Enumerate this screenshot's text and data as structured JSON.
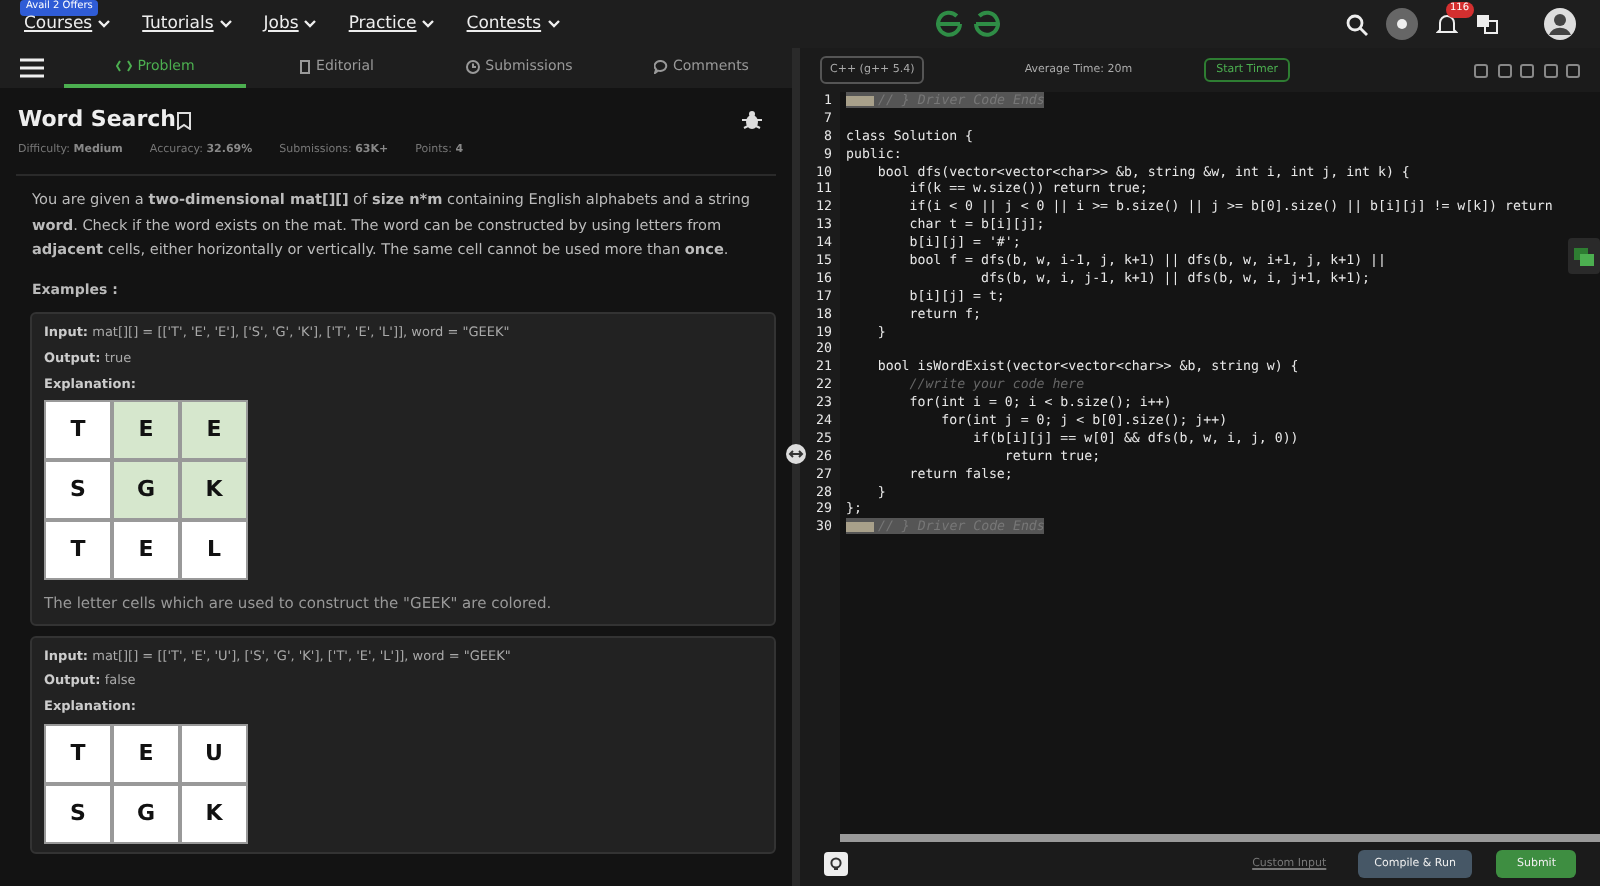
{
  "navbar": {
    "offer_badge": "Avail 2 Offers",
    "menus": [
      "Courses",
      "Tutorials",
      "Jobs",
      "Practice",
      "Contests"
    ],
    "notification_count": "116"
  },
  "tabs": [
    {
      "label": "Problem",
      "selected": true
    },
    {
      "label": "Editorial",
      "selected": false
    },
    {
      "label": "Submissions",
      "selected": false
    },
    {
      "label": "Comments",
      "selected": false
    }
  ],
  "problem": {
    "title": "Word Search",
    "meta": [
      {
        "label": "Difficulty:",
        "value": "Medium"
      },
      {
        "label": "Accuracy:",
        "value": "32.69%"
      },
      {
        "label": "Submissions:",
        "value": "63K+"
      },
      {
        "label": "Points:",
        "value": "4"
      }
    ],
    "description": "You are given a **two-dimensional mat[][]** of **size n*m** containing English alphabets and a string **word**. Check if the word exists on the mat. The word can be constructed by using letters from **adjacent** cells, either horizontally or vertically. The same cell cannot be used more than **once**.",
    "examples_heading": "Examples :",
    "examples": [
      {
        "input_label": "Input:",
        "input": "mat[][] = [['T', 'E', 'E'], ['S', 'G', 'K'], ['T', 'E', 'L']], word = \"GEEK\"",
        "output_label": "Output:",
        "output": "true",
        "explanation_label": "Explanation:",
        "grid": [
          [
            {
              "letter": "T",
              "highlighted": false
            },
            {
              "letter": "E",
              "highlighted": true
            },
            {
              "letter": "E",
              "highlighted": true
            }
          ],
          [
            {
              "letter": "S",
              "highlighted": false
            },
            {
              "letter": "G",
              "highlighted": true
            },
            {
              "letter": "K",
              "highlighted": true
            }
          ],
          [
            {
              "letter": "T",
              "highlighted": false
            },
            {
              "letter": "E",
              "highlighted": false
            },
            {
              "letter": "L",
              "highlighted": false
            }
          ]
        ],
        "note": "The letter cells which are used to construct the \"GEEK\" are colored."
      },
      {
        "input_label": "Input:",
        "input": "mat[][] = [['T', 'E', 'U'], ['S', 'G', 'K'], ['T', 'E', 'L']], word = \"GEEK\"",
        "output_label": "Output:",
        "output": "false",
        "explanation_label": "Explanation:",
        "grid": [
          [
            {
              "letter": "T",
              "highlighted": false
            },
            {
              "letter": "E",
              "highlighted": false
            },
            {
              "letter": "U",
              "highlighted": false
            }
          ],
          [
            {
              "letter": "S",
              "highlighted": false
            },
            {
              "letter": "G",
              "highlighted": false
            },
            {
              "letter": "K",
              "highlighted": false
            }
          ]
        ]
      }
    ]
  },
  "editor": {
    "language": "C++ (g++ 5.4)",
    "average_time": "Average Time: 20m",
    "timer_button": "Start Timer",
    "lines": [
      {
        "number": "1",
        "kind": "folded",
        "text": "// } Driver Code Ends"
      },
      {
        "number": "7",
        "kind": "code"
      },
      {
        "number": "8",
        "kind": "code",
        "text": "class Solution {"
      },
      {
        "number": "9",
        "kind": "code",
        "text": "public:"
      },
      {
        "number": "10",
        "kind": "code",
        "text": "    bool dfs(vector<vector<char>> &b, string &w, int i, int j, int k) {"
      },
      {
        "number": "11",
        "kind": "code",
        "text": "        if(k == w.size()) return true;"
      },
      {
        "number": "12",
        "kind": "code",
        "text": "        if(i < 0 || j < 0 || i >= b.size() || j >= b[0].size() || b[i][j] != w[k]) return"
      },
      {
        "number": "13",
        "kind": "code",
        "text": "        char t = b[i][j];"
      },
      {
        "number": "14",
        "kind": "code",
        "text": "        b[i][j] = '#';"
      },
      {
        "number": "15",
        "kind": "code",
        "text": "        bool f = dfs(b, w, i-1, j, k+1) || dfs(b, w, i+1, j, k+1) ||"
      },
      {
        "number": "16",
        "kind": "code",
        "text": "                 dfs(b, w, i, j-1, k+1) || dfs(b, w, i, j+1, k+1);"
      },
      {
        "number": "17",
        "kind": "code",
        "text": "        b[i][j] = t;"
      },
      {
        "number": "18",
        "kind": "code",
        "text": "        return f;"
      },
      {
        "number": "19",
        "kind": "code",
        "text": "    }"
      },
      {
        "number": "20",
        "kind": "code"
      },
      {
        "number": "21",
        "kind": "code",
        "text": "    bool isWordExist(vector<vector<char>> &b, string w) {"
      },
      {
        "number": "22",
        "kind": "comment",
        "text": "        //write your code here"
      },
      {
        "number": "23",
        "kind": "code",
        "text": "        for(int i = 0; i < b.size(); i++)"
      },
      {
        "number": "24",
        "kind": "code",
        "text": "            for(int j = 0; j < b[0].size(); j++)"
      },
      {
        "number": "25",
        "kind": "code",
        "text": "                if(b[i][j] == w[0] && dfs(b, w, i, j, 0))"
      },
      {
        "number": "26",
        "kind": "code",
        "text": "                    return true;"
      },
      {
        "number": "27",
        "kind": "code",
        "text": "        return false;"
      },
      {
        "number": "28",
        "kind": "code",
        "text": "    }"
      },
      {
        "number": "29",
        "kind": "code",
        "text": "};"
      },
      {
        "number": "30",
        "kind": "folded",
        "text": "// } Driver Code Ends"
      }
    ],
    "custom_input": "Custom Input",
    "compile_button": "Compile & Run",
    "submit_button": "Submit"
  }
}
